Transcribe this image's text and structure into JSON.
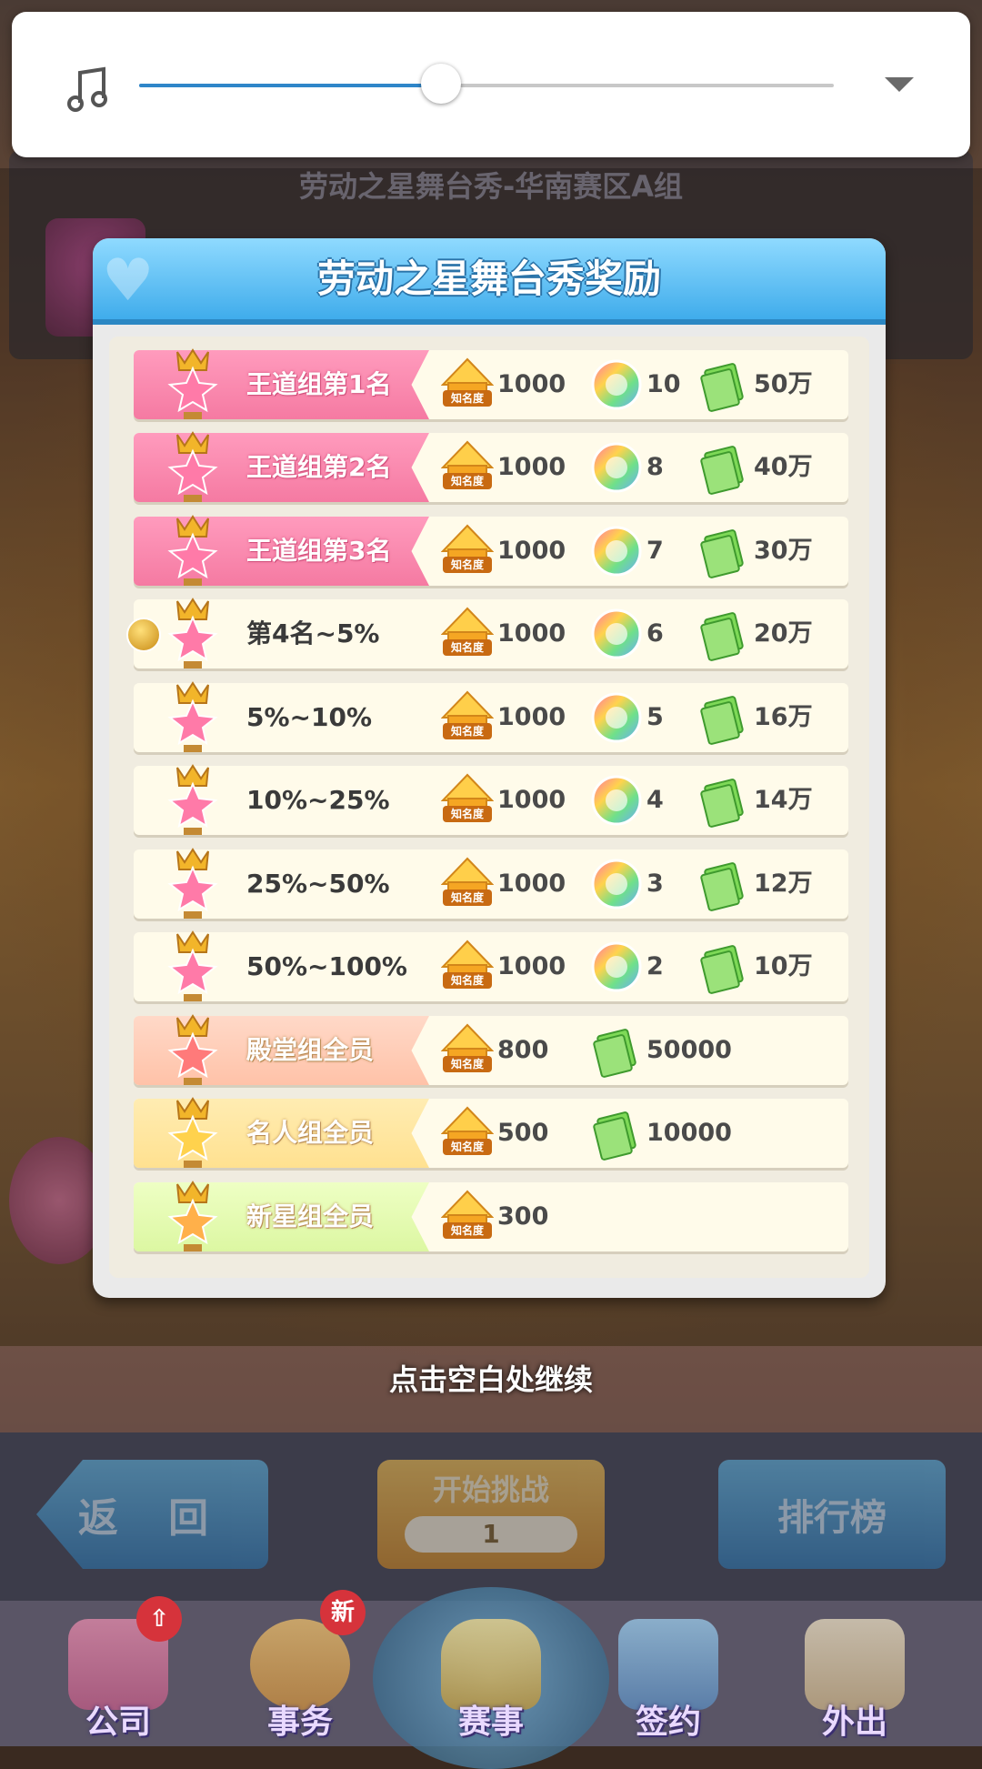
{
  "music": {
    "icon": "music-note-icon",
    "volume": 0.5,
    "dropdown_icon": "triangle-down-icon"
  },
  "background": {
    "header_title": "劳动之星舞台秀-华南赛区A组",
    "back_label": "返 回",
    "start_label": "开始挑战",
    "start_count": "1",
    "rank_label": "排行榜"
  },
  "nav": {
    "items": [
      {
        "label": "公司",
        "icon": "building-icon"
      },
      {
        "label": "事务",
        "icon": "manager-icon",
        "badge": "新"
      },
      {
        "label": "赛事",
        "icon": "trophy-icon"
      },
      {
        "label": "签约",
        "icon": "contract-icon"
      },
      {
        "label": "外出",
        "icon": "door-icon"
      }
    ]
  },
  "modal": {
    "title": "劳动之星舞台秀奖励",
    "fame_caption": "知名度",
    "rows": [
      {
        "label": "王道组第1名",
        "style": "pink",
        "fame": "1000",
        "gem": "10",
        "cash": "50万"
      },
      {
        "label": "王道组第2名",
        "style": "pink",
        "fame": "1000",
        "gem": "8",
        "cash": "40万"
      },
      {
        "label": "王道组第3名",
        "style": "pink",
        "fame": "1000",
        "gem": "7",
        "cash": "30万"
      },
      {
        "label": "第4名~5%",
        "style": "plain",
        "fame": "1000",
        "gem": "6",
        "cash": "20万"
      },
      {
        "label": "5%~10%",
        "style": "plain",
        "fame": "1000",
        "gem": "5",
        "cash": "16万"
      },
      {
        "label": "10%~25%",
        "style": "plain",
        "fame": "1000",
        "gem": "4",
        "cash": "14万"
      },
      {
        "label": "25%~50%",
        "style": "plain",
        "fame": "1000",
        "gem": "3",
        "cash": "12万"
      },
      {
        "label": "50%~100%",
        "style": "plain",
        "fame": "1000",
        "gem": "2",
        "cash": "10万"
      },
      {
        "label": "殿堂组全员",
        "style": "peach",
        "fame": "800",
        "cash": "50000"
      },
      {
        "label": "名人组全员",
        "style": "yellow",
        "fame": "500",
        "cash": "10000"
      },
      {
        "label": "新星组全员",
        "style": "green",
        "fame": "300"
      }
    ]
  },
  "continue_hint": "点击空白处继续",
  "colors": {
    "accent": "#2f86c9",
    "pink_tag": "#f57aa2",
    "modal_header": "#3aa9ea"
  }
}
